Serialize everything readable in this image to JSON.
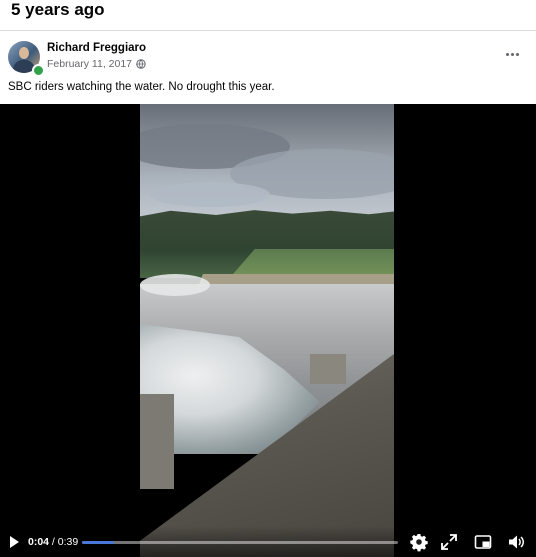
{
  "memory": {
    "title": "5 years ago"
  },
  "post": {
    "author": "Richard Freggiaro",
    "date": "February 11, 2017 · ",
    "privacy_icon": "globe-icon",
    "text": "SBC riders watching the water. No drought this year."
  },
  "video": {
    "current_time": "0:04",
    "separator": " / ",
    "duration": "0:39",
    "progress": 0.1,
    "accent": "#4a78d8",
    "icons": [
      "play-icon",
      "settings-icon",
      "fullscreen-icon",
      "miniplayer-icon",
      "volume-icon"
    ]
  },
  "colors": {
    "online": "#31a24c",
    "secondary_text": "#65676b"
  }
}
